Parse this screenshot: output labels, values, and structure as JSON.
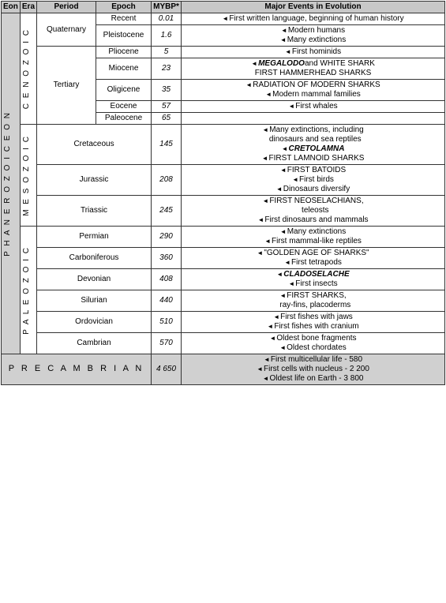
{
  "headers": {
    "eon": "Eon",
    "era": "Era",
    "period": "Period",
    "epoch": "Epoch",
    "mybp": "MYBP*",
    "events": "Major Events in Evolution"
  },
  "eons": {
    "phanerozoic": "P H A N E R O Z O I C   E O N",
    "precambrian": "P R E C A M B R I A N"
  },
  "eras": {
    "cenozoic": "C E N O Z O I C",
    "mesozoic": "M E S O Z O I C",
    "paleozoic": "P A L E O Z O I C"
  },
  "rows": [
    {
      "period": "Quaternary",
      "epoch": "Recent",
      "mybp": "0.01",
      "events": "First written language, beginning of human history"
    },
    {
      "period": "",
      "epoch": "Pleistocene",
      "mybp": "1.6",
      "events": "Modern humans\nMany extinctions"
    },
    {
      "period": "Tertiary",
      "epoch": "Pliocene",
      "mybp": "5",
      "events": "First hominids"
    },
    {
      "period": "",
      "epoch": "Miocene",
      "mybp": "23",
      "events": "MEGALODO and WHITE SHARK\nFIRST HAMMERHEAD SHARKS"
    },
    {
      "period": "",
      "epoch": "Oligicene",
      "mybp": "35",
      "events": "RADIATION OF MODERN SHARKS\nModern mammal families"
    },
    {
      "period": "",
      "epoch": "Eocene",
      "mybp": "57",
      "events": "First whales"
    },
    {
      "period": "",
      "epoch": "Paleocene",
      "mybp": "65",
      "events": ""
    },
    {
      "period": "Cretaceous",
      "epoch": "",
      "mybp": "145",
      "events": "Many extinctions, including dinosaurs and sea reptiles\nCRETOLAMNA\nFIRST LAMNOID SHARKS"
    },
    {
      "period": "Jurassic",
      "epoch": "",
      "mybp": "208",
      "events": "FIRST BATOIDS\nFirst birds\nDinosaurs diversify"
    },
    {
      "period": "Triassic",
      "epoch": "",
      "mybp": "245",
      "events": "FIRST NEOSELACHIANS, teleosts\nFirst dinosaurs and mammals"
    },
    {
      "period": "Permian",
      "epoch": "",
      "mybp": "290",
      "events": "Many extinctions\nFirst mammal-like reptiles"
    },
    {
      "period": "Carboniferous",
      "epoch": "",
      "mybp": "360",
      "events": "\"GOLDEN AGE OF SHARKS\"\nFirst tetrapods"
    },
    {
      "period": "Devonian",
      "epoch": "",
      "mybp": "408",
      "events": "CLADOSELACHE\nFirst insects"
    },
    {
      "period": "Silurian",
      "epoch": "",
      "mybp": "440",
      "events": "FIRST SHARKS,\nray-fins, placoderms"
    },
    {
      "period": "Ordovician",
      "epoch": "",
      "mybp": "510",
      "events": "First fishes with jaws\nFirst fishes with cranium"
    },
    {
      "period": "Cambrian",
      "epoch": "",
      "mybp": "570",
      "events": "Oldest bone fragments\nOldest chordates"
    }
  ],
  "precambrian_events": [
    "First multicellular life - 580",
    "First cells with nucleus - 2 200",
    "Oldest life on Earth - 3 800"
  ]
}
